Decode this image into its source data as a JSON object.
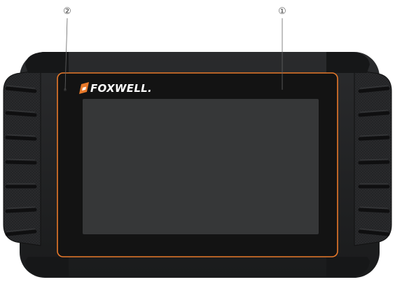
{
  "device": {
    "brand": "FOXWELL.",
    "body_color": "#1e1f21",
    "bezel_color": "#141414",
    "screen_color": "#363738",
    "accent_color": "#e8792a",
    "power_button_color": "#c8302a"
  },
  "callouts": [
    {
      "number": "①",
      "refers_to": "screen"
    },
    {
      "number": "②",
      "refers_to": "ambient-light-sensor"
    }
  ],
  "icons": {
    "brand_logo": "foxwell-logo-icon",
    "power_button": "power-button-icon"
  }
}
